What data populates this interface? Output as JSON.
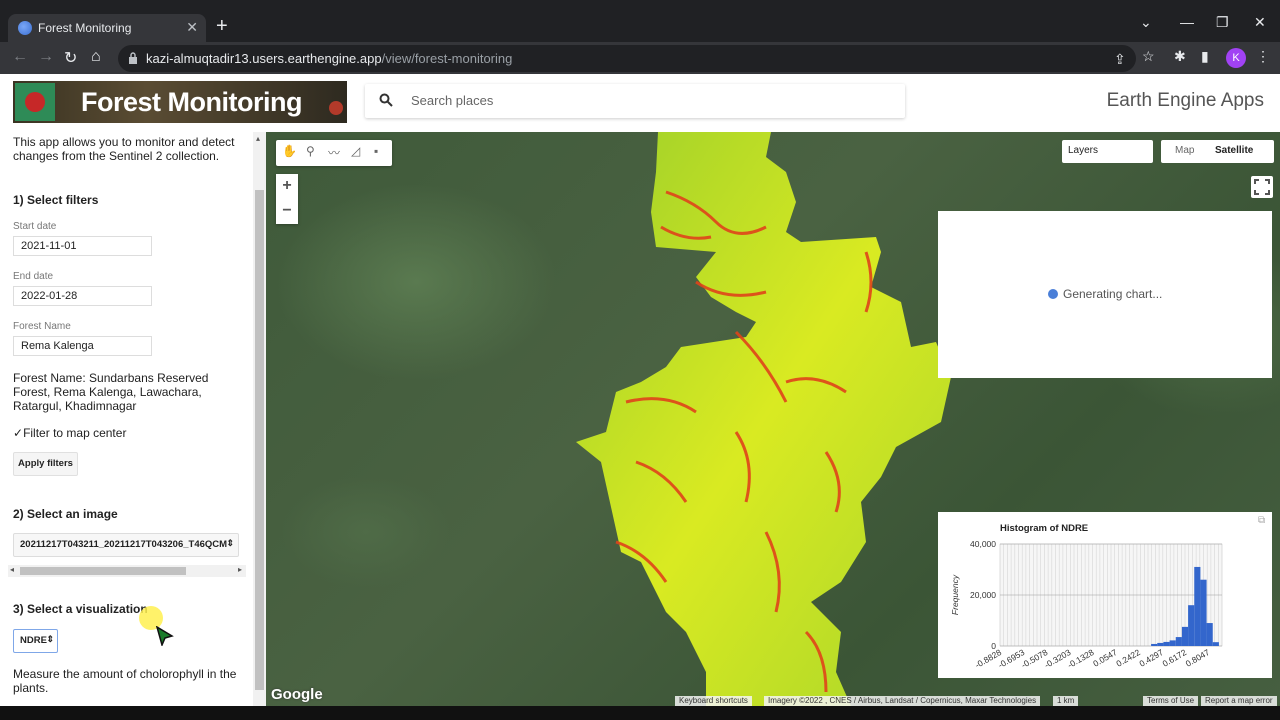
{
  "browser": {
    "tab_title": "Forest Monitoring",
    "tab_close": "✕",
    "new_tab": "+",
    "url_host": "kazi-almuqtadir13.users.earthengine.app",
    "url_path": "/view/forest-monitoring",
    "profile_initial": "K"
  },
  "header": {
    "banner_title": "Forest Monitoring",
    "search_placeholder": "Search places",
    "brand": "Earth Engine Apps"
  },
  "panel": {
    "intro": "This app allows you to monitor and detect changes from the Sentinel 2 collection.",
    "section1": "1) Select filters",
    "start_label": "Start date",
    "start_value": "2021-11-01",
    "end_label": "End date",
    "end_value": "2022-01-28",
    "forest_label": "Forest Name",
    "forest_value": "Rema Kalenga",
    "forest_names": "Forest Name: Sundarbans Reserved Forest, Rema Kalenga, Lawachara, Ratargul, Khadimnagar",
    "filter_checkbox": "Filter to map center",
    "apply_button": "Apply filters",
    "section2": "2) Select an image",
    "image_value": "20211217T043211_20211217T043206_T46QCM",
    "section3": "3) Select a visualization",
    "vis_value": "NDRE",
    "vis_desc": "Measure the amount of cholorophyll in the plants."
  },
  "map": {
    "layers_label": "Layers",
    "maptype_map": "Map",
    "maptype_satellite": "Satellite",
    "zoom_in": "+",
    "zoom_out": "−",
    "generating": "Generating chart...",
    "google": "Google",
    "attrib_shortcuts": "Keyboard shortcuts",
    "attrib_imagery": "Imagery ©2022 , CNES / Airbus, Landsat / Copernicus, Maxar Technologies",
    "attrib_scale": "1 km",
    "attrib_terms": "Terms of Use",
    "attrib_report": "Report a map error"
  },
  "colors": {
    "forest_green": "#7dc22b",
    "forest_yellow": "#e8f020",
    "forest_red": "#e2451a",
    "bar_color": "#3366cc"
  },
  "chart_data": {
    "type": "bar",
    "title": "Histogram of NDRE",
    "ylabel": "Frequency",
    "xlabel": "",
    "ylim": [
      0,
      40000
    ],
    "yticks": [
      "40,000",
      "20,000",
      "0"
    ],
    "xticks": [
      "-0.8828",
      "-0.6953",
      "-0.5078",
      "-0.3203",
      "-0.1328",
      "0.0547",
      "0.2422",
      "0.4297",
      "0.6172",
      "0.8047"
    ],
    "x": [
      -0.85,
      -0.8,
      -0.75,
      -0.7,
      -0.65,
      -0.6,
      -0.55,
      -0.5,
      -0.45,
      -0.4,
      -0.35,
      -0.3,
      -0.25,
      -0.2,
      -0.15,
      -0.1,
      -0.05,
      0.0,
      0.05,
      0.1,
      0.15,
      0.2,
      0.25,
      0.3,
      0.35,
      0.4,
      0.45,
      0.5,
      0.55,
      0.6,
      0.65,
      0.7,
      0.75,
      0.8,
      0.85
    ],
    "values": [
      0,
      0,
      0,
      0,
      0,
      0,
      0,
      0,
      0,
      0,
      0,
      0,
      0,
      0,
      0,
      0,
      0,
      0,
      0,
      0,
      0,
      0,
      0,
      0,
      800,
      1200,
      1600,
      2200,
      3500,
      7500,
      16000,
      31000,
      26000,
      9000,
      1500
    ]
  }
}
